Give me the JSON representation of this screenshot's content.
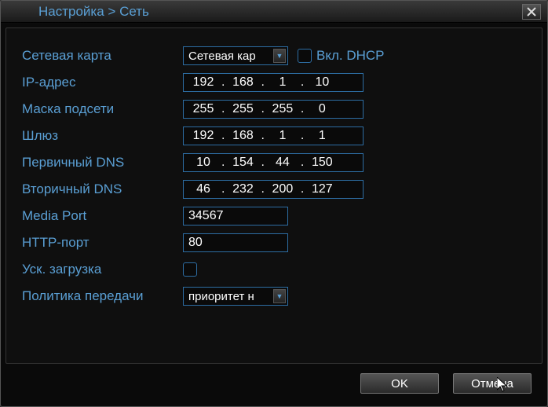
{
  "title": "Настройка > Сеть",
  "labels": {
    "card": "Сетевая карта",
    "ip": "IP-адрес",
    "mask": "Маска подсети",
    "gateway": "Шлюз",
    "dns1": "Первичный DNS",
    "dns2": "Вторичный DNS",
    "media_port": "Media Port",
    "http_port": "HTTP-порт",
    "fast_dl": "Уск. загрузка",
    "policy": "Политика передачи",
    "dhcp": "Вкл. DHCP"
  },
  "values": {
    "card": "Сетевая кар",
    "ip": [
      "192",
      "168",
      "1",
      "10"
    ],
    "mask": [
      "255",
      "255",
      "255",
      "0"
    ],
    "gateway": [
      "192",
      "168",
      "1",
      "1"
    ],
    "dns1": [
      "10",
      "154",
      "44",
      "150"
    ],
    "dns2": [
      "46",
      "232",
      "200",
      "127"
    ],
    "media_port": "34567",
    "http_port": "80",
    "fast_dl": false,
    "dhcp": false,
    "policy": "приоритет н"
  },
  "buttons": {
    "ok": "OK",
    "cancel": "Отмена"
  }
}
